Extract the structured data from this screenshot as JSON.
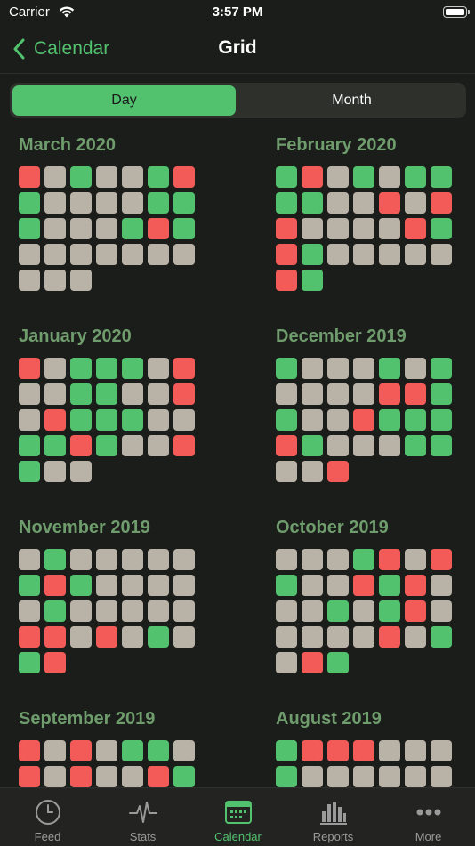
{
  "status_bar": {
    "carrier": "Carrier",
    "time": "3:57 PM"
  },
  "nav": {
    "back_label": "Calendar",
    "title": "Grid"
  },
  "segmented": {
    "day": "Day",
    "month": "Month",
    "selected": "day"
  },
  "colors": {
    "green": "#52c26f",
    "red": "#f25b57",
    "gray": "#b9b2a6",
    "title": "#6f9c6c",
    "accent": "#52c26f"
  },
  "months": [
    {
      "title": "March 2020",
      "days": "RGGGGGRGGGGGGGGGGGGRGGGGGGGGGGG",
      "colors": "rggggggggggggggggrgggggggggggg"
    },
    {
      "title": "February 2020"
    },
    {
      "title": "January 2020"
    },
    {
      "title": "December 2019"
    },
    {
      "title": "November 2019"
    },
    {
      "title": "October 2019"
    },
    {
      "title": "September 2019"
    },
    {
      "title": "August 2019"
    }
  ],
  "grids": [
    "RWGWWGRGWWWWGGGWWWGRGWWWWWWWWWW",
    "GRWGWGGGGWWRWRRWWWWRGRGWWWWWRG",
    "RWGGGWRWWGGWWRWRGGGWWGGRGWWRGWW",
    "GWWWGWGWWWWRRGGWWRGGGRGWWWGGWWR",
    "WGWWWWWGRGWWWWWGWWWWWRRWRWGWGR",
    "WWWGRWRGWWRGRWWWGWGRWWWWWRWGWRG",
    "RWRWGGWRWRWWRG",
    "GRRRWWWGWWWWWW"
  ],
  "tabs": [
    {
      "label": "Feed",
      "icon": "clock-icon"
    },
    {
      "label": "Stats",
      "icon": "pulse-icon"
    },
    {
      "label": "Calendar",
      "icon": "calendar-icon",
      "active": true
    },
    {
      "label": "Reports",
      "icon": "bar-chart-icon"
    },
    {
      "label": "More",
      "icon": "ellipsis-icon"
    }
  ]
}
